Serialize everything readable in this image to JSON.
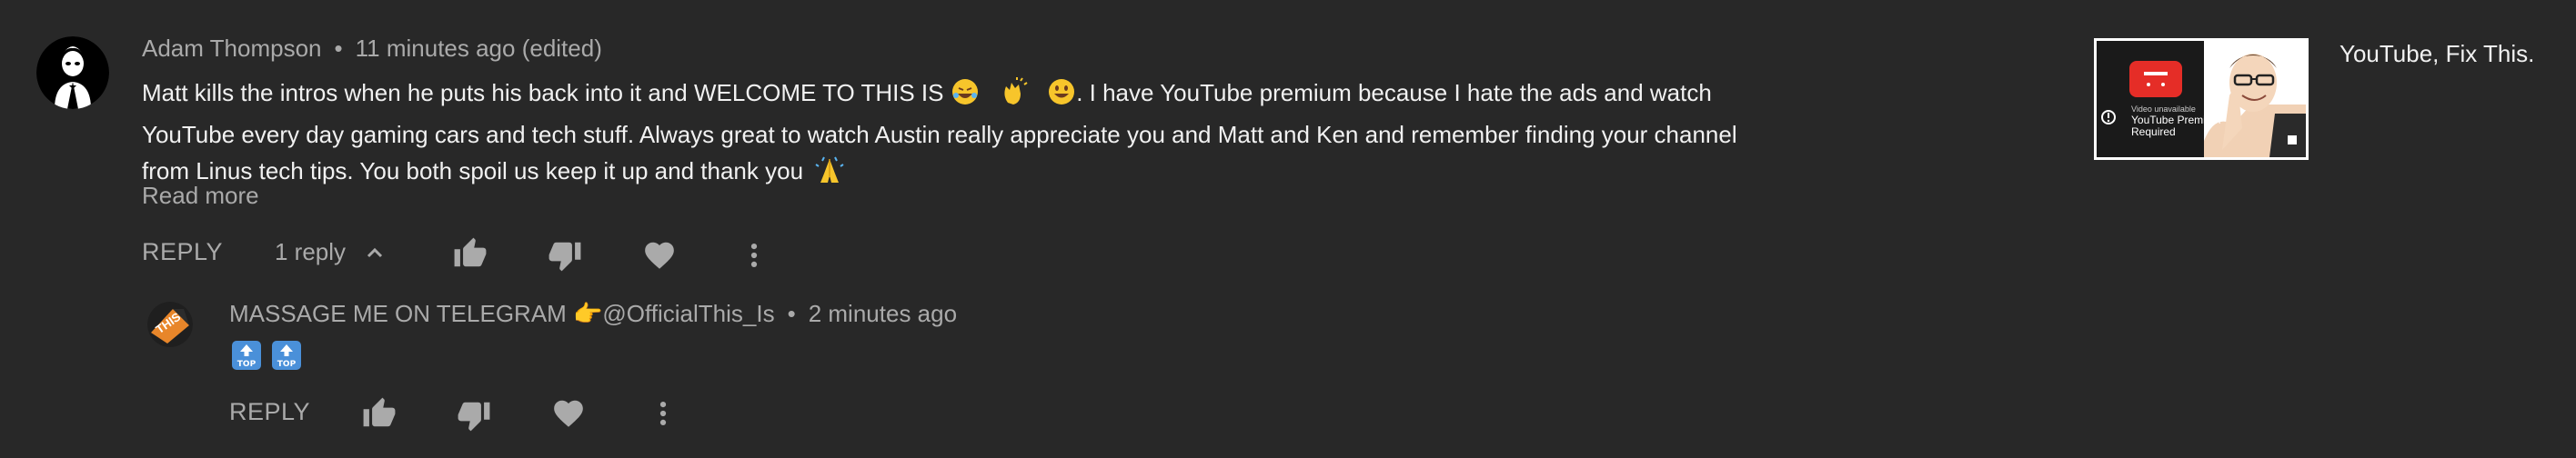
{
  "comment": {
    "author": "Adam Thompson",
    "separator": "•",
    "time": "11 minutes ago (edited)",
    "lines": [
      "Matt kills the intros when he puts his back into it and WELCOME TO THIS IS",
      ". I have YouTube premium because I hate the ads and watch",
      "YouTube every day gaming cars and tech stuff. Always great to watch Austin really appreciate you and Matt and Ken and remember finding your channel",
      "from Linus tech tips. You both spoil us keep it up and thank you"
    ],
    "read_more": "Read more",
    "reply_label": "REPLY",
    "replies_count": "1 reply"
  },
  "reply": {
    "author": "MASSAGE ME ON TELEGRAM 👉@OfficialThis_Is",
    "separator": "•",
    "time": "2 minutes ago",
    "reply_label": "REPLY"
  },
  "video": {
    "title": "YouTube, Fix This.",
    "thumb_line1": "Video unavailable",
    "thumb_line2": "YouTube Premium",
    "thumb_line3": "Required"
  },
  "avatar_badge": "THIS"
}
